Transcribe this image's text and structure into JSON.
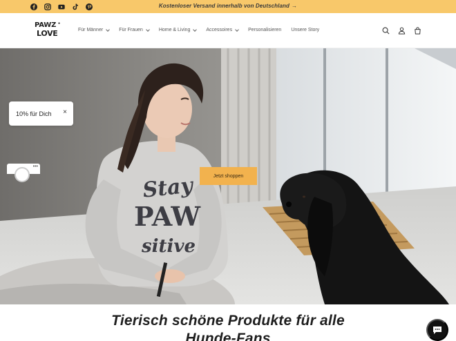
{
  "announcement": {
    "text": "Kostenloser Versand innerhalb von Deutschland",
    "arrow": "→"
  },
  "socials": [
    "facebook-icon",
    "instagram-icon",
    "youtube-icon",
    "tiktok-icon",
    "pinterest-icon"
  ],
  "logo": {
    "line1": "PAWZ",
    "line2": "LOVE"
  },
  "nav": [
    {
      "label": "Für Männer",
      "dropdown": true
    },
    {
      "label": "Für Frauen",
      "dropdown": true
    },
    {
      "label": "Home & Living",
      "dropdown": true
    },
    {
      "label": "Accessoires",
      "dropdown": true
    },
    {
      "label": "Personalisieren",
      "dropdown": false
    },
    {
      "label": "Unsere Story",
      "dropdown": false
    }
  ],
  "header_icons": [
    "search-icon",
    "account-icon",
    "cart-icon"
  ],
  "hero": {
    "cta_label": "Jetzt shoppen",
    "shirt_print": [
      "Stay",
      "PAW",
      "sitive"
    ]
  },
  "promo": {
    "label": "10% für Dich",
    "close": "×"
  },
  "headline": "Tierisch schöne Produkte für alle Hunde-Fans",
  "colors": {
    "announcement_bg": "#f8c86a",
    "cta_bg": "#f2b24e",
    "text_dark": "#1e1e1e"
  }
}
